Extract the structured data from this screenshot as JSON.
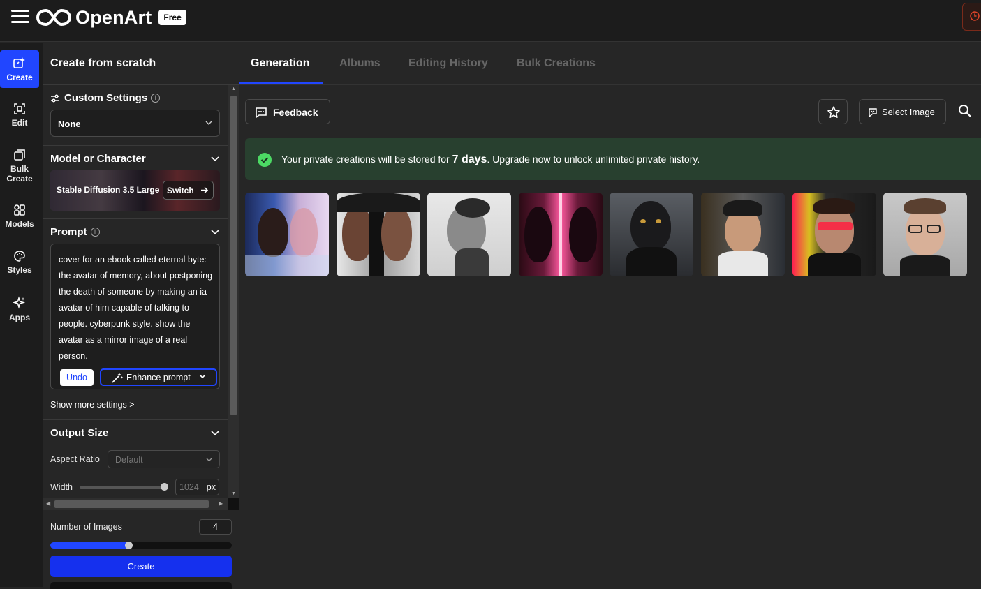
{
  "app": {
    "name": "OpenArt",
    "plan_badge": "Free"
  },
  "leftnav": {
    "items": [
      {
        "label": "Create",
        "icon": "create-sparkle-icon",
        "active": true
      },
      {
        "label": "Edit",
        "icon": "edit-frame-icon"
      },
      {
        "label": "Bulk Create",
        "icon": "bulk-create-icon"
      },
      {
        "label": "Models",
        "icon": "models-grid-icon"
      },
      {
        "label": "Styles",
        "icon": "styles-palette-icon"
      },
      {
        "label": "Apps",
        "icon": "apps-sparkle-icon"
      }
    ]
  },
  "panel": {
    "title": "Create from scratch",
    "custom_settings": {
      "label": "Custom Settings",
      "value": "None"
    },
    "model": {
      "label": "Model or Character",
      "name": "Stable Diffusion 3.5 Large",
      "switch_label": "Switch"
    },
    "prompt": {
      "label": "Prompt",
      "text": "cover for an ebook called eternal byte: the avatar of memory, about postponing the death of someone by making an ia avatar of him capable of talking to people. cyberpunk style. show the avatar as a mirror image of a real person.",
      "undo_label": "Undo",
      "enhance_label": "Enhance prompt"
    },
    "show_more": "Show more settings >",
    "output_size": {
      "label": "Output Size",
      "aspect_label": "Aspect Ratio",
      "aspect_value": "Default",
      "width_label": "Width",
      "width_value": "1024",
      "width_unit": "px",
      "width_slider_fraction": 1.0
    },
    "num_images": {
      "label": "Number of Images",
      "value": "4",
      "slider_fraction": 0.43
    },
    "create_label": "Create"
  },
  "main": {
    "tabs": [
      {
        "label": "Generation",
        "active": true
      },
      {
        "label": "Albums"
      },
      {
        "label": "Editing History"
      },
      {
        "label": "Bulk Creations"
      }
    ],
    "feedback_label": "Feedback",
    "select_image_label": "Select Image",
    "banner": {
      "prefix": "Your private creations will be stored for",
      "highlight": "7 days",
      "suffix": ". Upgrade now to unlock unlimited private history."
    },
    "thumbnails": [
      {
        "name": "mirror-portrait-blue-pink"
      },
      {
        "name": "cyborg-split-face"
      },
      {
        "name": "android-profile-dissolving"
      },
      {
        "name": "neon-mirror-profiles"
      },
      {
        "name": "robot-head-city"
      },
      {
        "name": "man-with-glasses-city"
      },
      {
        "name": "man-red-glasses-neon"
      },
      {
        "name": "woman-with-glasses"
      }
    ]
  },
  "colors": {
    "accent": "#2146ff",
    "banner_bg": "#28402f",
    "success": "#4cd964",
    "background": "#262626"
  }
}
